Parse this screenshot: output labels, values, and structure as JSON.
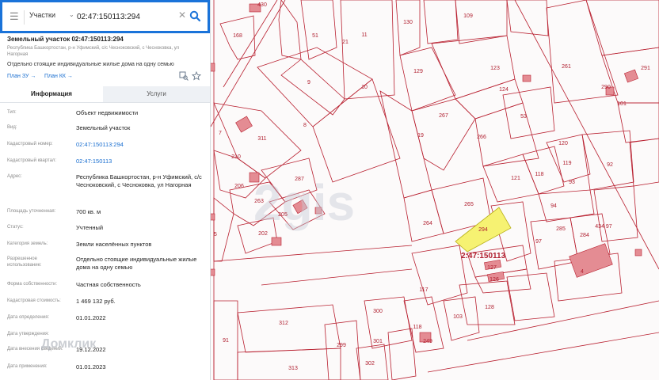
{
  "search": {
    "category": "Участки",
    "value": "02:47:150113:294"
  },
  "object": {
    "title": "Земельный участок 02:47:150113:294",
    "address_short": "Республика Башкортостан, р-н Уфимский, с/с Чесноковский, с Чесноковка, ул Нагорная",
    "description": "Отдельно стоящие индивидуальные жилые дома на одну семью",
    "links": [
      "План ЗУ →",
      "План КК →"
    ]
  },
  "tabs": [
    "Информация",
    "Услуги"
  ],
  "info_rows": [
    {
      "key": "Тип:",
      "value": "Объект недвижимости",
      "link": false
    },
    {
      "key": "Вид:",
      "value": "Земельный участок",
      "link": false
    },
    {
      "key": "Кадастровый номер:",
      "value": "02:47:150113:294",
      "link": true
    },
    {
      "key": "Кадастровый квартал:",
      "value": "02:47:150113",
      "link": true
    },
    {
      "key": "Адрес:",
      "value": "Республика Башкортостан, р-н Уфимский, с/с Чесноковский, с Чесноковка, ул Нагорная",
      "link": false
    },
    {
      "key": "Площадь уточненная:",
      "value": "700 кв. м",
      "link": false
    },
    {
      "key": "Статус:",
      "value": "Учтенный",
      "link": false
    },
    {
      "key": "Категория земель:",
      "value": "Земли населённых пунктов",
      "link": false
    },
    {
      "key": "Разрешенное использование:",
      "value": "Отдельно стоящие индивидуальные жилые дома на одну семью",
      "link": false
    },
    {
      "key": "Форма собственности:",
      "value": "Частная собственность",
      "link": false
    },
    {
      "key": "Кадастровая стоимость:",
      "value": "1 469 132 руб.",
      "link": false
    },
    {
      "key": "Дата определения:",
      "value": "01.01.2022",
      "link": false
    },
    {
      "key": "Дата утверждения:",
      "value": "",
      "link": false
    },
    {
      "key": "Дата внесения сведений:",
      "value": "19.12.2022",
      "link": false
    },
    {
      "key": "Дата применения:",
      "value": "01.01.2023",
      "link": false
    }
  ],
  "watermarks": {
    "map": "2gis",
    "panel": "Домклик"
  },
  "map": {
    "quarter_label": "2:47:150113",
    "selected_parcel": "294",
    "parcel_labels": [
      "430",
      "168",
      "51",
      "11",
      "130",
      "109",
      "8",
      "21",
      "9",
      "10",
      "129",
      "123",
      "124",
      "291",
      "290",
      "261",
      "101",
      "311",
      "267",
      "19",
      "266",
      "53",
      "120",
      "119",
      "118",
      "93",
      "92",
      "94",
      "210",
      "287",
      "265",
      "121",
      "206",
      "263",
      "205",
      "264",
      "285",
      "284",
      "434",
      "7",
      "202",
      "294",
      "127",
      "126",
      "97",
      "117",
      "128",
      "5",
      "91",
      "300",
      "118",
      "103",
      "312",
      "299",
      "301",
      "313",
      "302",
      "249",
      "4"
    ],
    "colors": {
      "parcel_line": "#b81f2f",
      "building_fill": "#e48c93",
      "selected_fill": "#f6f272",
      "accent": "#1a73d9"
    }
  }
}
